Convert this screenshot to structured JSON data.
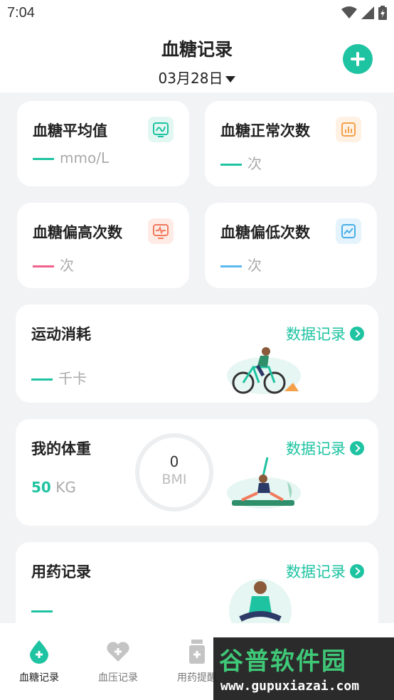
{
  "status": {
    "time": "7:04"
  },
  "header": {
    "title": "血糖记录",
    "date": "03月28日"
  },
  "stats": [
    {
      "title": "血糖平均值",
      "value": "mmo/L",
      "dash_color": "#1ec3a1",
      "icon": "glucose-chart-icon",
      "icon_bg": "#e3f7f2",
      "icon_color": "#1ec3a1"
    },
    {
      "title": "血糖正常次数",
      "value": "次",
      "dash_color": "#1ec3a1",
      "icon": "bar-chart-icon",
      "icon_bg": "#fff1e4",
      "icon_color": "#f5a14a"
    },
    {
      "title": "血糖偏高次数",
      "value": "次",
      "dash_color": "#f0608a",
      "icon": "monitor-pulse-icon",
      "icon_bg": "#ffebe6",
      "icon_color": "#f27a5c"
    },
    {
      "title": "血糖偏低次数",
      "value": "次",
      "dash_color": "#5bb8ee",
      "icon": "line-chart-icon",
      "icon_bg": "#e5f4fc",
      "icon_color": "#4aaee8"
    }
  ],
  "exercise": {
    "title": "运动消耗",
    "link": "数据记录",
    "value": "千卡"
  },
  "weight": {
    "title": "我的体重",
    "link": "数据记录",
    "value_num": "50",
    "value_unit": "KG",
    "bmi_value": "0",
    "bmi_label": "BMI"
  },
  "medication": {
    "title": "用药记录",
    "link": "数据记录"
  },
  "tabs": [
    {
      "label": "血糖记录",
      "icon": "drop-plus-icon",
      "active": true
    },
    {
      "label": "血压记录",
      "icon": "heart-plus-icon",
      "active": false
    },
    {
      "label": "用药提醒",
      "icon": "pill-bottle-icon",
      "active": false
    }
  ],
  "watermark": {
    "title": "谷普软件园",
    "url": "www.gupuxiazai.com"
  },
  "colors": {
    "accent": "#1ec3a1"
  }
}
